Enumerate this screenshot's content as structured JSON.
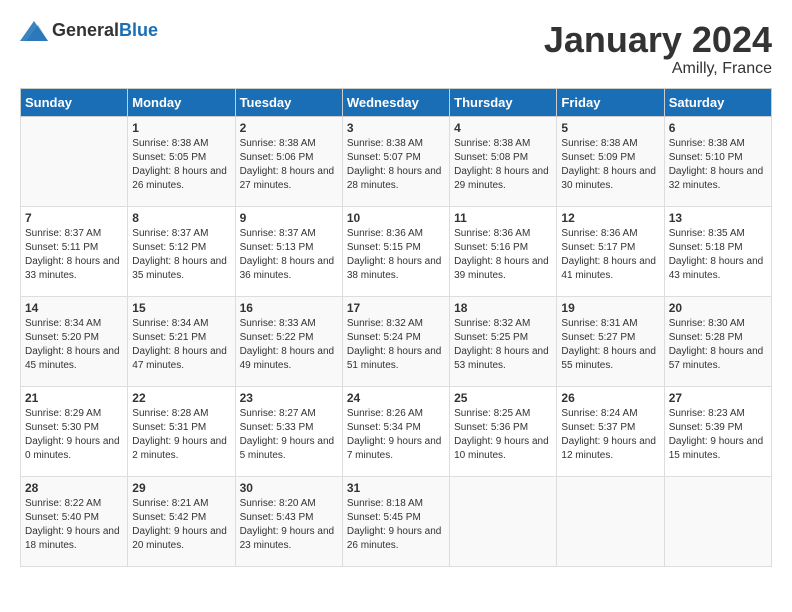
{
  "header": {
    "logo_general": "General",
    "logo_blue": "Blue",
    "month_year": "January 2024",
    "location": "Amilly, France"
  },
  "weekdays": [
    "Sunday",
    "Monday",
    "Tuesday",
    "Wednesday",
    "Thursday",
    "Friday",
    "Saturday"
  ],
  "weeks": [
    [
      {
        "day": "",
        "sunrise": "",
        "sunset": "",
        "daylight": ""
      },
      {
        "day": "1",
        "sunrise": "Sunrise: 8:38 AM",
        "sunset": "Sunset: 5:05 PM",
        "daylight": "Daylight: 8 hours and 26 minutes."
      },
      {
        "day": "2",
        "sunrise": "Sunrise: 8:38 AM",
        "sunset": "Sunset: 5:06 PM",
        "daylight": "Daylight: 8 hours and 27 minutes."
      },
      {
        "day": "3",
        "sunrise": "Sunrise: 8:38 AM",
        "sunset": "Sunset: 5:07 PM",
        "daylight": "Daylight: 8 hours and 28 minutes."
      },
      {
        "day": "4",
        "sunrise": "Sunrise: 8:38 AM",
        "sunset": "Sunset: 5:08 PM",
        "daylight": "Daylight: 8 hours and 29 minutes."
      },
      {
        "day": "5",
        "sunrise": "Sunrise: 8:38 AM",
        "sunset": "Sunset: 5:09 PM",
        "daylight": "Daylight: 8 hours and 30 minutes."
      },
      {
        "day": "6",
        "sunrise": "Sunrise: 8:38 AM",
        "sunset": "Sunset: 5:10 PM",
        "daylight": "Daylight: 8 hours and 32 minutes."
      }
    ],
    [
      {
        "day": "7",
        "sunrise": "Sunrise: 8:37 AM",
        "sunset": "Sunset: 5:11 PM",
        "daylight": "Daylight: 8 hours and 33 minutes."
      },
      {
        "day": "8",
        "sunrise": "Sunrise: 8:37 AM",
        "sunset": "Sunset: 5:12 PM",
        "daylight": "Daylight: 8 hours and 35 minutes."
      },
      {
        "day": "9",
        "sunrise": "Sunrise: 8:37 AM",
        "sunset": "Sunset: 5:13 PM",
        "daylight": "Daylight: 8 hours and 36 minutes."
      },
      {
        "day": "10",
        "sunrise": "Sunrise: 8:36 AM",
        "sunset": "Sunset: 5:15 PM",
        "daylight": "Daylight: 8 hours and 38 minutes."
      },
      {
        "day": "11",
        "sunrise": "Sunrise: 8:36 AM",
        "sunset": "Sunset: 5:16 PM",
        "daylight": "Daylight: 8 hours and 39 minutes."
      },
      {
        "day": "12",
        "sunrise": "Sunrise: 8:36 AM",
        "sunset": "Sunset: 5:17 PM",
        "daylight": "Daylight: 8 hours and 41 minutes."
      },
      {
        "day": "13",
        "sunrise": "Sunrise: 8:35 AM",
        "sunset": "Sunset: 5:18 PM",
        "daylight": "Daylight: 8 hours and 43 minutes."
      }
    ],
    [
      {
        "day": "14",
        "sunrise": "Sunrise: 8:34 AM",
        "sunset": "Sunset: 5:20 PM",
        "daylight": "Daylight: 8 hours and 45 minutes."
      },
      {
        "day": "15",
        "sunrise": "Sunrise: 8:34 AM",
        "sunset": "Sunset: 5:21 PM",
        "daylight": "Daylight: 8 hours and 47 minutes."
      },
      {
        "day": "16",
        "sunrise": "Sunrise: 8:33 AM",
        "sunset": "Sunset: 5:22 PM",
        "daylight": "Daylight: 8 hours and 49 minutes."
      },
      {
        "day": "17",
        "sunrise": "Sunrise: 8:32 AM",
        "sunset": "Sunset: 5:24 PM",
        "daylight": "Daylight: 8 hours and 51 minutes."
      },
      {
        "day": "18",
        "sunrise": "Sunrise: 8:32 AM",
        "sunset": "Sunset: 5:25 PM",
        "daylight": "Daylight: 8 hours and 53 minutes."
      },
      {
        "day": "19",
        "sunrise": "Sunrise: 8:31 AM",
        "sunset": "Sunset: 5:27 PM",
        "daylight": "Daylight: 8 hours and 55 minutes."
      },
      {
        "day": "20",
        "sunrise": "Sunrise: 8:30 AM",
        "sunset": "Sunset: 5:28 PM",
        "daylight": "Daylight: 8 hours and 57 minutes."
      }
    ],
    [
      {
        "day": "21",
        "sunrise": "Sunrise: 8:29 AM",
        "sunset": "Sunset: 5:30 PM",
        "daylight": "Daylight: 9 hours and 0 minutes."
      },
      {
        "day": "22",
        "sunrise": "Sunrise: 8:28 AM",
        "sunset": "Sunset: 5:31 PM",
        "daylight": "Daylight: 9 hours and 2 minutes."
      },
      {
        "day": "23",
        "sunrise": "Sunrise: 8:27 AM",
        "sunset": "Sunset: 5:33 PM",
        "daylight": "Daylight: 9 hours and 5 minutes."
      },
      {
        "day": "24",
        "sunrise": "Sunrise: 8:26 AM",
        "sunset": "Sunset: 5:34 PM",
        "daylight": "Daylight: 9 hours and 7 minutes."
      },
      {
        "day": "25",
        "sunrise": "Sunrise: 8:25 AM",
        "sunset": "Sunset: 5:36 PM",
        "daylight": "Daylight: 9 hours and 10 minutes."
      },
      {
        "day": "26",
        "sunrise": "Sunrise: 8:24 AM",
        "sunset": "Sunset: 5:37 PM",
        "daylight": "Daylight: 9 hours and 12 minutes."
      },
      {
        "day": "27",
        "sunrise": "Sunrise: 8:23 AM",
        "sunset": "Sunset: 5:39 PM",
        "daylight": "Daylight: 9 hours and 15 minutes."
      }
    ],
    [
      {
        "day": "28",
        "sunrise": "Sunrise: 8:22 AM",
        "sunset": "Sunset: 5:40 PM",
        "daylight": "Daylight: 9 hours and 18 minutes."
      },
      {
        "day": "29",
        "sunrise": "Sunrise: 8:21 AM",
        "sunset": "Sunset: 5:42 PM",
        "daylight": "Daylight: 9 hours and 20 minutes."
      },
      {
        "day": "30",
        "sunrise": "Sunrise: 8:20 AM",
        "sunset": "Sunset: 5:43 PM",
        "daylight": "Daylight: 9 hours and 23 minutes."
      },
      {
        "day": "31",
        "sunrise": "Sunrise: 8:18 AM",
        "sunset": "Sunset: 5:45 PM",
        "daylight": "Daylight: 9 hours and 26 minutes."
      },
      {
        "day": "",
        "sunrise": "",
        "sunset": "",
        "daylight": ""
      },
      {
        "day": "",
        "sunrise": "",
        "sunset": "",
        "daylight": ""
      },
      {
        "day": "",
        "sunrise": "",
        "sunset": "",
        "daylight": ""
      }
    ]
  ]
}
